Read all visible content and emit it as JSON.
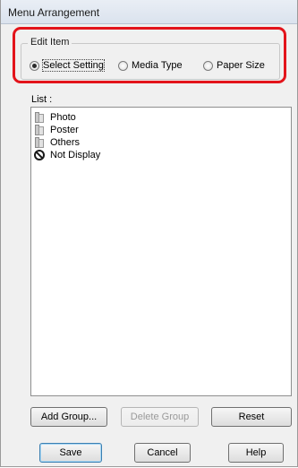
{
  "window": {
    "title": "Menu Arrangement"
  },
  "edit_item": {
    "label": "Edit Item",
    "options": [
      {
        "label": "Select Setting",
        "checked": true
      },
      {
        "label": "Media Type",
        "checked": false
      },
      {
        "label": "Paper Size",
        "checked": false
      }
    ]
  },
  "list": {
    "label": "List :",
    "items": [
      {
        "label": "Photo",
        "icon": "folder-icon"
      },
      {
        "label": "Poster",
        "icon": "folder-icon"
      },
      {
        "label": "Others",
        "icon": "folder-icon"
      },
      {
        "label": "Not Display",
        "icon": "no-entry-icon"
      }
    ]
  },
  "buttons": {
    "add_group": "Add Group...",
    "delete_group": "Delete Group",
    "reset": "Reset",
    "save": "Save",
    "cancel": "Cancel",
    "help": "Help"
  },
  "colors": {
    "highlight": "#e3141b",
    "dialog_bg": "#f0f0f0"
  }
}
